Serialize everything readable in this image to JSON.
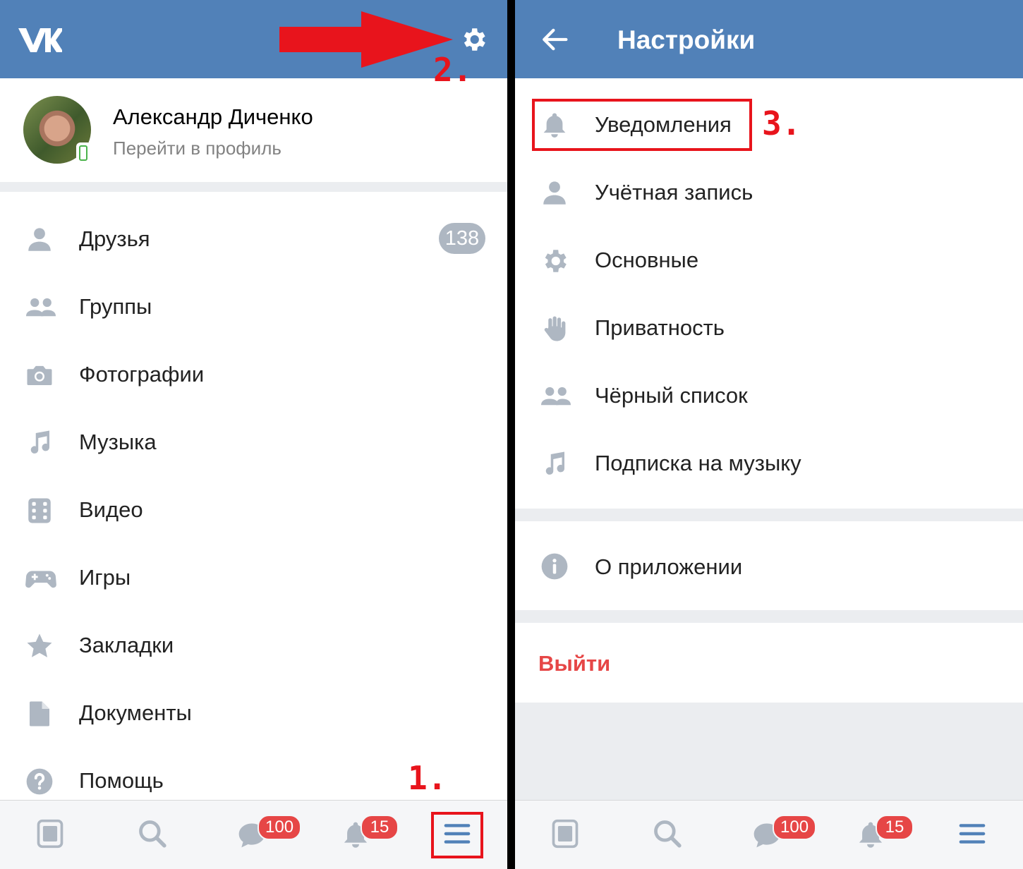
{
  "left": {
    "profile": {
      "name": "Александр Диченко",
      "subtitle": "Перейти в профиль"
    },
    "menu": [
      {
        "label": "Друзья",
        "icon": "person-icon",
        "badge": "138"
      },
      {
        "label": "Группы",
        "icon": "people-icon"
      },
      {
        "label": "Фотографии",
        "icon": "camera-icon"
      },
      {
        "label": "Музыка",
        "icon": "music-note-icon"
      },
      {
        "label": "Видео",
        "icon": "film-icon"
      },
      {
        "label": "Игры",
        "icon": "gamepad-icon"
      },
      {
        "label": "Закладки",
        "icon": "star-icon"
      },
      {
        "label": "Документы",
        "icon": "document-icon"
      },
      {
        "label": "Помощь",
        "icon": "help-icon"
      }
    ],
    "tabbar": {
      "messages_badge": "100",
      "notifications_badge": "15"
    }
  },
  "right": {
    "header_title": "Настройки",
    "settings": [
      {
        "label": "Уведомления",
        "icon": "bell-icon"
      },
      {
        "label": "Учётная запись",
        "icon": "person-icon"
      },
      {
        "label": "Основные",
        "icon": "gear-icon"
      },
      {
        "label": "Приватность",
        "icon": "hand-icon"
      },
      {
        "label": "Чёрный список",
        "icon": "people-icon"
      },
      {
        "label": "Подписка на музыку",
        "icon": "music-note-icon"
      }
    ],
    "about": {
      "label": "О приложении",
      "icon": "info-icon"
    },
    "logout": {
      "label": "Выйти"
    },
    "tabbar": {
      "messages_badge": "100",
      "notifications_badge": "15"
    }
  },
  "annotations": {
    "step1": "1.",
    "step2": "2.",
    "step3": "3."
  },
  "colors": {
    "header": "#5181b8",
    "accent": "#5181b8",
    "icon": "#aeb7c2",
    "logout": "#e64646",
    "badge": "#e64646",
    "annotation": "#e8141c"
  }
}
